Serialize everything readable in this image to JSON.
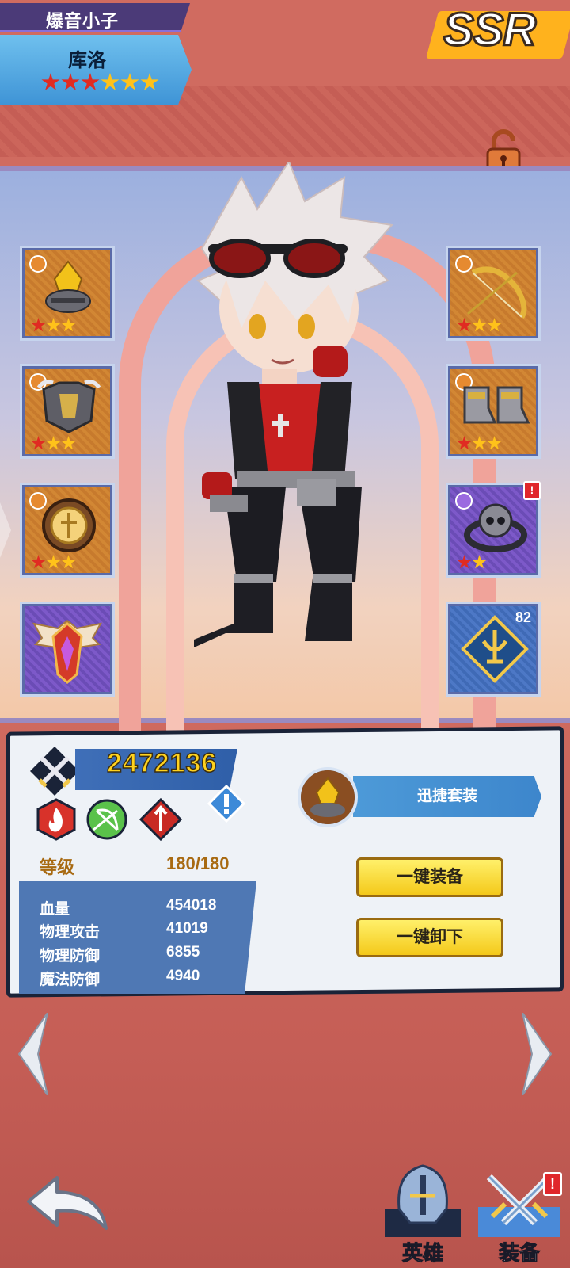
{
  "header": {
    "title": "爆音小子",
    "hero_name": "库洛",
    "stars_red": 3,
    "stars_gold": 3,
    "rarity": "SSR"
  },
  "equipment": {
    "left": [
      {
        "name": "helmet",
        "stars": 3
      },
      {
        "name": "armor",
        "stars": 3
      },
      {
        "name": "shield",
        "stars": 3
      },
      {
        "name": "wings-emblem",
        "stars": 0
      }
    ],
    "right": [
      {
        "name": "bow",
        "stars": 3
      },
      {
        "name": "boots",
        "stars": 3
      },
      {
        "name": "skull-ring",
        "stars": 2,
        "alert": "!"
      },
      {
        "name": "rune-emblem",
        "level": "82"
      }
    ]
  },
  "info": {
    "power": "2472136",
    "level_label": "等级",
    "level_value": "180/180",
    "stats": [
      {
        "label": "血量",
        "value": "454018"
      },
      {
        "label": "物理攻击",
        "value": "41019"
      },
      {
        "label": "物理防御",
        "value": "6855"
      },
      {
        "label": "魔法防御",
        "value": "4940"
      }
    ],
    "set_name": "迅捷套装",
    "equip_all_label": "一键装备",
    "unequip_all_label": "一键卸下"
  },
  "bottom_nav": {
    "hero_label": "英雄",
    "equip_label": "装备",
    "equip_alert": "!"
  },
  "colors": {
    "power": "#ffd21e",
    "level": "#a86a12",
    "accent_blue": "#4f78b4",
    "button_yellow": "#f4c91a"
  }
}
